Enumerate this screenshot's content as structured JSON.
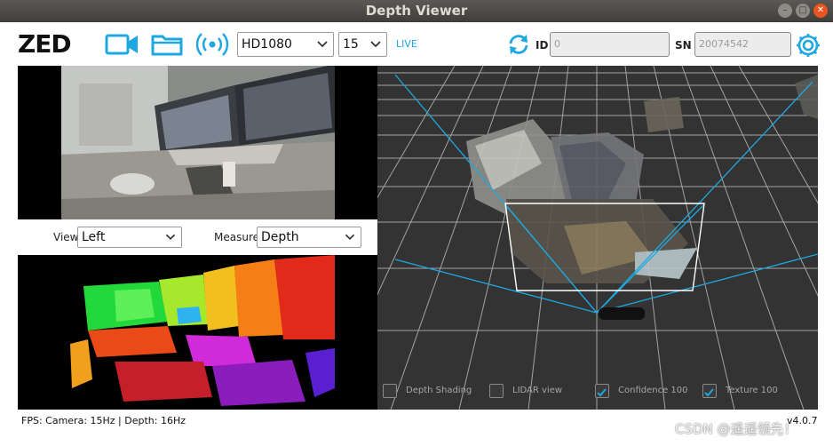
{
  "window": {
    "title": "Depth Viewer"
  },
  "toolbar": {
    "logo": "ZED",
    "resolution": {
      "selected": "HD1080"
    },
    "fps": {
      "selected": "15"
    },
    "live_label": "LIVE",
    "id_label": "ID",
    "id_placeholder": "0",
    "sn_label": "SN",
    "sn_placeholder": "20074542"
  },
  "left_panel": {
    "view_label": "View",
    "view_selected": "Left",
    "measure_label": "Measure",
    "measure_selected": "Depth"
  },
  "view3d": {
    "options": [
      {
        "label": "Depth Shading",
        "checked": false
      },
      {
        "label": "LIDAR view",
        "checked": false
      },
      {
        "label": "Confidence 100",
        "checked": true
      },
      {
        "label": "Texture 100",
        "checked": true
      }
    ]
  },
  "status": {
    "fps_text": "FPS: Camera: 15Hz | Depth: 16Hz",
    "version": "v4.0.7"
  },
  "watermark": "CSDN @遥遥领先！",
  "colors": {
    "accent": "#1ea7e1",
    "titlebar": "#3f3e3a",
    "close": "#e95420",
    "viewport": "#333333"
  }
}
